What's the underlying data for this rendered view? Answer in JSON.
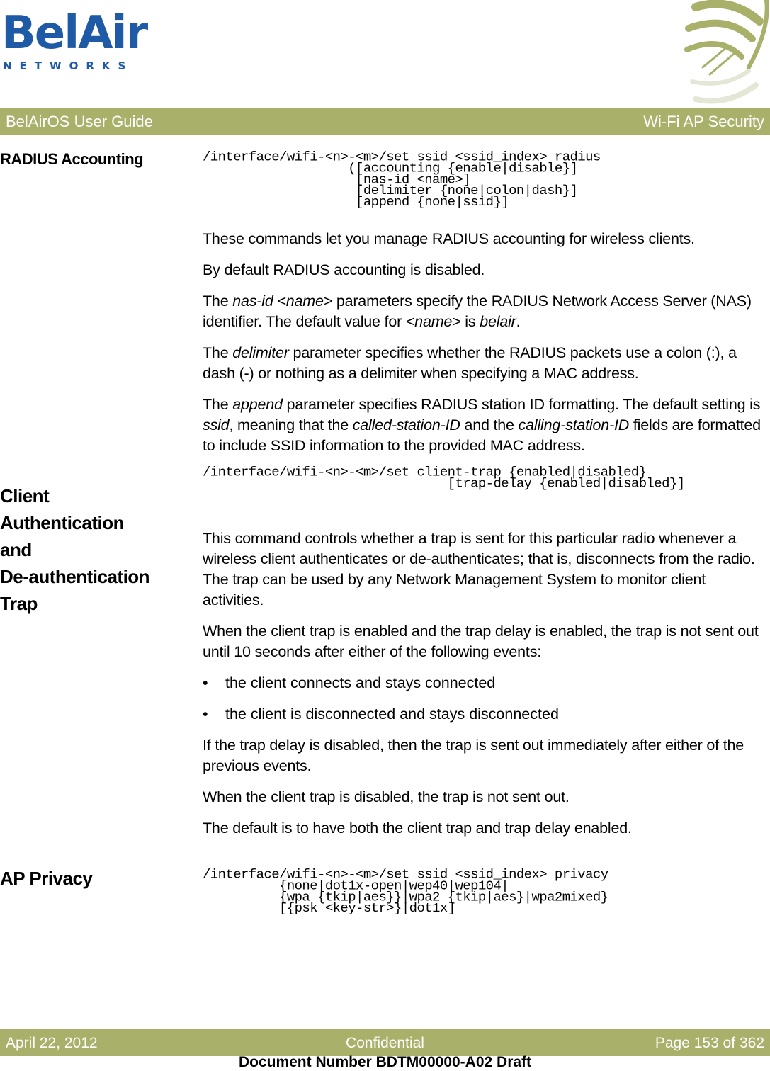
{
  "header": {
    "logo_main": "BelAir",
    "logo_sub": "NETWORKS",
    "guide_title": "BelAirOS User Guide",
    "chapter_title": "Wi-Fi AP Security",
    "accent_color": "#a8b06a",
    "logo_color": "#1f5aa6"
  },
  "sections": {
    "radius": {
      "title": "RADIUS Accounting",
      "command": "/interface/wifi-<n>-<m>/set ssid <ssid_index> radius\n                   ([accounting {enable|disable}]\n                    [nas-id <name>]\n                    [delimiter {none|colon|dash}]\n                    [append {none|ssid}]",
      "p1": "These commands let you manage RADIUS accounting for wireless clients.",
      "p2": "By default RADIUS accounting is disabled.",
      "p3": {
        "a": "The ",
        "b": "nas-id <name>",
        "c": " parameters specify the RADIUS Network Access Server (NAS) identifier. The default value for ",
        "d": "<name>",
        "e": " is ",
        "f": "belair",
        "g": "."
      },
      "p4": {
        "a": "The ",
        "b": "delimiter",
        "c": " parameter specifies whether the RADIUS packets use a colon (:), a dash (-) or nothing as a delimiter when specifying a MAC address."
      },
      "p5": {
        "a": "The ",
        "b": "append",
        "c": " parameter specifies RADIUS station ID formatting. The default setting is ",
        "d": "ssid",
        "e": ", meaning that the ",
        "f": "called-station-ID",
        "g": " and the ",
        "h": "calling-station-ID",
        "i": " fields are formatted to include SSID information to the provided MAC address."
      }
    },
    "client_trap": {
      "title_lines": [
        "Client",
        "Authentication",
        "and",
        "De-authentication",
        "Trap"
      ],
      "command": "/interface/wifi-<n>-<m>/set client-trap {enabled|disabled}\n                                [trap-delay {enabled|disabled}]",
      "p1": "This command controls whether a trap is sent for this particular radio whenever a wireless client authenticates or de-authenticates; that is, disconnects from the radio. The trap can be used by any Network Management System to monitor client activities.",
      "p2": "When the client trap is enabled and the trap delay is enabled, the trap is not sent out until 10 seconds after either of the following events:",
      "bullets": [
        "the client connects and stays connected",
        "the client is disconnected and stays disconnected"
      ],
      "bullet_char": "•",
      "p3": "If the trap delay is disabled, then the trap is sent out immediately after either of the previous events.",
      "p4": "When the client trap is disabled, the trap is not sent out.",
      "p5": "The default is to have both the client trap and trap delay enabled."
    },
    "ap_privacy": {
      "title": "AP Privacy",
      "command": "/interface/wifi-<n>-<m>/set ssid <ssid_index> privacy\n          {none|dot1x-open|wep40|wep104|\n          {wpa {tkip|aes}}|wpa2 {tkip|aes}|wpa2mixed}\n          [{psk <key-str>}|dot1x]"
    }
  },
  "footer": {
    "date": "April 22, 2012",
    "classification": "Confidential",
    "page": "Page 153 of 362",
    "doc_number": "Document Number BDTM00000-A02 Draft"
  }
}
